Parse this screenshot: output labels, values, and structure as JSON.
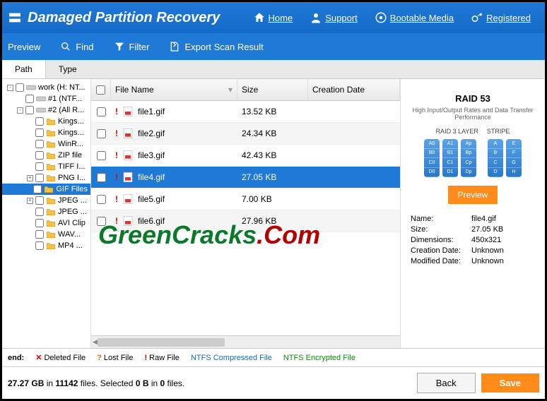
{
  "header": {
    "title": "Damaged Partition Recovery",
    "nav": {
      "home": "Home",
      "support": "Support",
      "bootable": "Bootable Media",
      "registered": "Registered"
    }
  },
  "toolbar": {
    "preview": "Preview",
    "find": "Find",
    "filter": "Filter",
    "export": "Export Scan Result"
  },
  "tabs": {
    "path": "Path",
    "type": "Type"
  },
  "tree": [
    {
      "label": "work (H: NT...",
      "level": 0,
      "kind": "disk",
      "exp": "-"
    },
    {
      "label": "#1 (NTF...",
      "level": 1,
      "kind": "drive",
      "exp": ""
    },
    {
      "label": "#2 (All R...",
      "level": 1,
      "kind": "drive",
      "exp": "-"
    },
    {
      "label": "Kings...",
      "level": 2,
      "kind": "folder",
      "exp": ""
    },
    {
      "label": "Kings...",
      "level": 2,
      "kind": "folder",
      "exp": ""
    },
    {
      "label": "WinR...",
      "level": 2,
      "kind": "folder",
      "exp": ""
    },
    {
      "label": "ZIP file",
      "level": 2,
      "kind": "folder",
      "exp": ""
    },
    {
      "label": "TIFF I...",
      "level": 2,
      "kind": "folder",
      "exp": ""
    },
    {
      "label": "PNG I...",
      "level": 2,
      "kind": "folder",
      "exp": "+"
    },
    {
      "label": "GIF Files",
      "level": 2,
      "kind": "folder",
      "exp": "",
      "selected": true
    },
    {
      "label": "JPEG ...",
      "level": 2,
      "kind": "folder",
      "exp": "+"
    },
    {
      "label": "JPEG ...",
      "level": 2,
      "kind": "folder",
      "exp": ""
    },
    {
      "label": "AVI Clip",
      "level": 2,
      "kind": "folder",
      "exp": ""
    },
    {
      "label": "WAV...",
      "level": 2,
      "kind": "folder",
      "exp": ""
    },
    {
      "label": "MP4 ...",
      "level": 2,
      "kind": "folder",
      "exp": ""
    }
  ],
  "columns": {
    "name": "File Name",
    "size": "Size",
    "date": "Creation Date"
  },
  "files": [
    {
      "name": "file1.gif",
      "size": "13.52 KB"
    },
    {
      "name": "file2.gif",
      "size": "24.34 KB"
    },
    {
      "name": "file3.gif",
      "size": "42.43 KB"
    },
    {
      "name": "file4.gif",
      "size": "27.05 KB",
      "selected": true
    },
    {
      "name": "file5.gif",
      "size": "7.00 KB"
    },
    {
      "name": "file6.gif",
      "size": "27.96 KB"
    }
  ],
  "preview": {
    "title": "RAID 53",
    "sub": "High Input/Output Rates and Data Transfer Performance",
    "layer1": "RAID 3 LAYER",
    "layer2": "STRIPE",
    "btn": "Preview",
    "meta": {
      "name_k": "Name:",
      "name_v": "file4.gif",
      "size_k": "Size:",
      "size_v": "27.05 KB",
      "dim_k": "Dimensions:",
      "dim_v": "450x321",
      "cdate_k": "Creation Date:",
      "cdate_v": "Unknown",
      "mdate_k": "Modified Date:",
      "mdate_v": "Unknown"
    }
  },
  "legend": {
    "prefix": "end:",
    "deleted": "Deleted File",
    "lost": "Lost File",
    "raw": "Raw File",
    "compressed": "NTFS Compressed File",
    "encrypted": "NTFS Encrypted File"
  },
  "status": {
    "text_a": " ",
    "size": "27.27 GB",
    "text_b": " in ",
    "count": "11142",
    "text_c": " files.  Selected ",
    "sel_b": "0 B",
    "text_d": " in ",
    "sel_n": "0",
    "text_e": " files.",
    "back": "Back",
    "save": "Save"
  },
  "watermark": {
    "a": "GreenCracks",
    "b": ".Com"
  }
}
